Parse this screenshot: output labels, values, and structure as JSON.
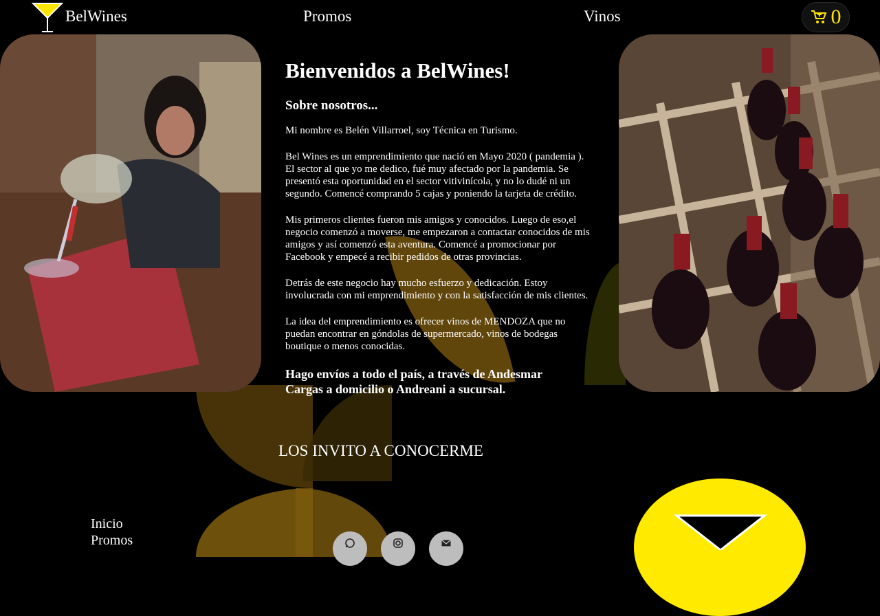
{
  "header": {
    "brand": "BelWines",
    "nav": {
      "promos": "Promos",
      "vinos": "Vinos"
    },
    "cart_count": "0"
  },
  "main": {
    "title": "Bienvenidos a BelWines!",
    "subtitle": "Sobre nosotros...",
    "paragraphs": [
      "Mi nombre es Belén Villarroel, soy Técnica en Turismo.",
      "Bel Wines es un emprendimiento que nació en Mayo 2020 ( pandemia ). El sector al que yo me dedico, fué muy afectado por la pandemia. Se presentó esta oportunidad en el sector vitivinícola, y no lo dudé ni un segundo. Comencé comprando 5 cajas y poniendo la tarjeta de crédito.",
      "Mis primeros clientes fueron mis amigos y conocidos. Luego de eso,el negocio comenzó a moverse, me empezaron a contactar conocidos de mis amigos y así comenzó esta aventura. Comencé a promocionar por Facebook y empecé a recibir pedidos de otras provincias.",
      "Detrás de este negocio hay mucho esfuerzo y dedicación. Estoy involucrada con mi emprendimiento y con la satisfacción de mis clientes.",
      "La idea del emprendimiento es ofrecer vinos de MENDOZA que no puedan encontrar en góndolas de supermercado, vinos de bodegas boutique o menos conocidas."
    ],
    "shipping": "Hago envíos a todo el país, a través de Andesmar Cargas a domicilio o Andreani a sucursal.",
    "cta": "LOS INVITO A CONOCERME"
  },
  "footer": {
    "links": [
      "Inicio",
      "Promos"
    ],
    "social_icons": [
      "whatsapp-icon",
      "instagram-icon",
      "mail-icon"
    ]
  },
  "colors": {
    "accent": "#ffe600",
    "background": "#000000",
    "leaf": "#8a6410"
  }
}
